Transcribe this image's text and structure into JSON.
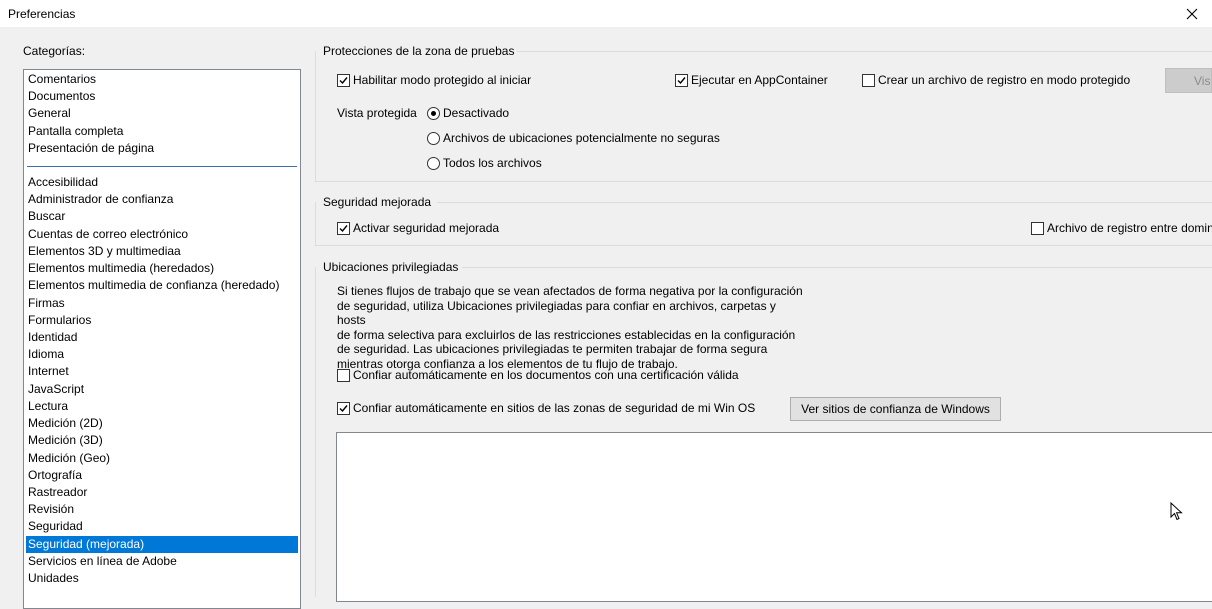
{
  "window": {
    "title": "Preferencias"
  },
  "categories": {
    "label": "Categorías:",
    "top_items": [
      "Comentarios",
      "Documentos",
      "General",
      "Pantalla completa",
      "Presentación de página"
    ],
    "items": [
      "Accesibilidad",
      "Administrador de confianza",
      "Buscar",
      "Cuentas de correo electrónico",
      "Elementos 3D y multimediaa",
      "Elementos multimedia (heredados)",
      "Elementos multimedia de confianza (heredado)",
      "Firmas",
      "Formularios",
      "Identidad",
      "Idioma",
      "Internet",
      "JavaScript",
      "Lectura",
      "Medición (2D)",
      "Medición (3D)",
      "Medición (Geo)",
      "Ortografía",
      "Rastreador",
      "Revisión",
      "Seguridad",
      "Seguridad (mejorada)",
      "Servicios en línea de Adobe",
      "Unidades"
    ],
    "selected": "Seguridad (mejorada)"
  },
  "sandbox": {
    "title": "Protecciones de la zona de pruebas",
    "protected_mode_label": "Habilitar modo protegido al iniciar",
    "protected_mode_checked": true,
    "appcontainer_label": "Ejecutar en AppContainer",
    "appcontainer_checked": true,
    "log_file_label": "Crear un archivo de registro en modo protegido",
    "log_file_checked": false,
    "view_button_label": "Visualizar",
    "protected_view_label": "Vista protegida",
    "protected_view_options": [
      "Desactivado",
      "Archivos de ubicaciones potencialmente no seguras",
      "Todos los archivos"
    ],
    "protected_view_selected": "Desactivado"
  },
  "enhanced": {
    "title": "Seguridad mejorada",
    "enable_label": "Activar seguridad mejorada",
    "enable_checked": true,
    "cross_domain_label": "Archivo de registro entre dominios",
    "cross_domain_checked": false
  },
  "privileged": {
    "title": "Ubicaciones privilegiadas",
    "description_lines": [
      "Si tienes flujos de trabajo que se vean afectados de forma negativa por la configuración",
      "de seguridad, utiliza Ubicaciones privilegiadas para confiar en archivos, carpetas y hosts",
      "de forma selectiva para excluirlos de las restricciones establecidas en la configuración",
      "de seguridad. Las ubicaciones privilegiadas te permiten trabajar de forma segura",
      "mientras otorga confianza a los elementos de tu flujo de trabajo."
    ],
    "trust_certified_label": "Confiar automáticamente en los documentos con una certificación válida",
    "trust_certified_checked": false,
    "trust_win_zones_label": "Confiar automáticamente en sitios de las zonas de seguridad de mi Win OS",
    "trust_win_zones_checked": true,
    "view_windows_sites_label": "Ver sitios de confianza de Windows"
  }
}
